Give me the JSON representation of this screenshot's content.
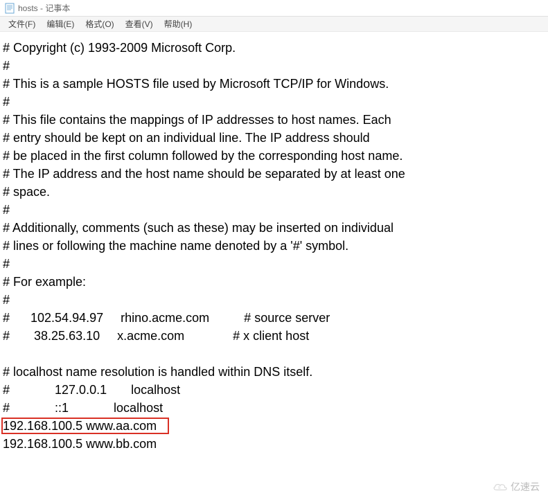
{
  "window": {
    "title": "hosts - 记事本"
  },
  "menu": {
    "file": "文件(F)",
    "edit": "编辑(E)",
    "format": "格式(O)",
    "view": "查看(V)",
    "help": "帮助(H)"
  },
  "content": {
    "lines": [
      "# Copyright (c) 1993-2009 Microsoft Corp.",
      "#",
      "# This is a sample HOSTS file used by Microsoft TCP/IP for Windows.",
      "#",
      "# This file contains the mappings of IP addresses to host names. Each",
      "# entry should be kept on an individual line. The IP address should",
      "# be placed in the first column followed by the corresponding host name.",
      "# The IP address and the host name should be separated by at least one",
      "# space.",
      "#",
      "# Additionally, comments (such as these) may be inserted on individual",
      "# lines or following the machine name denoted by a '#' symbol.",
      "#",
      "# For example:",
      "#",
      "#      102.54.94.97     rhino.acme.com          # source server",
      "#       38.25.63.10     x.acme.com              # x client host",
      "",
      "# localhost name resolution is handled within DNS itself.",
      "#             127.0.0.1       localhost",
      "#             ::1             localhost",
      "192.168.100.5 www.aa.com",
      "192.168.100.5 www.bb.com"
    ]
  },
  "highlight": {
    "line_index": 21,
    "text": "192.168.100.5 www.aa.com"
  },
  "watermark": {
    "text": "亿速云"
  }
}
